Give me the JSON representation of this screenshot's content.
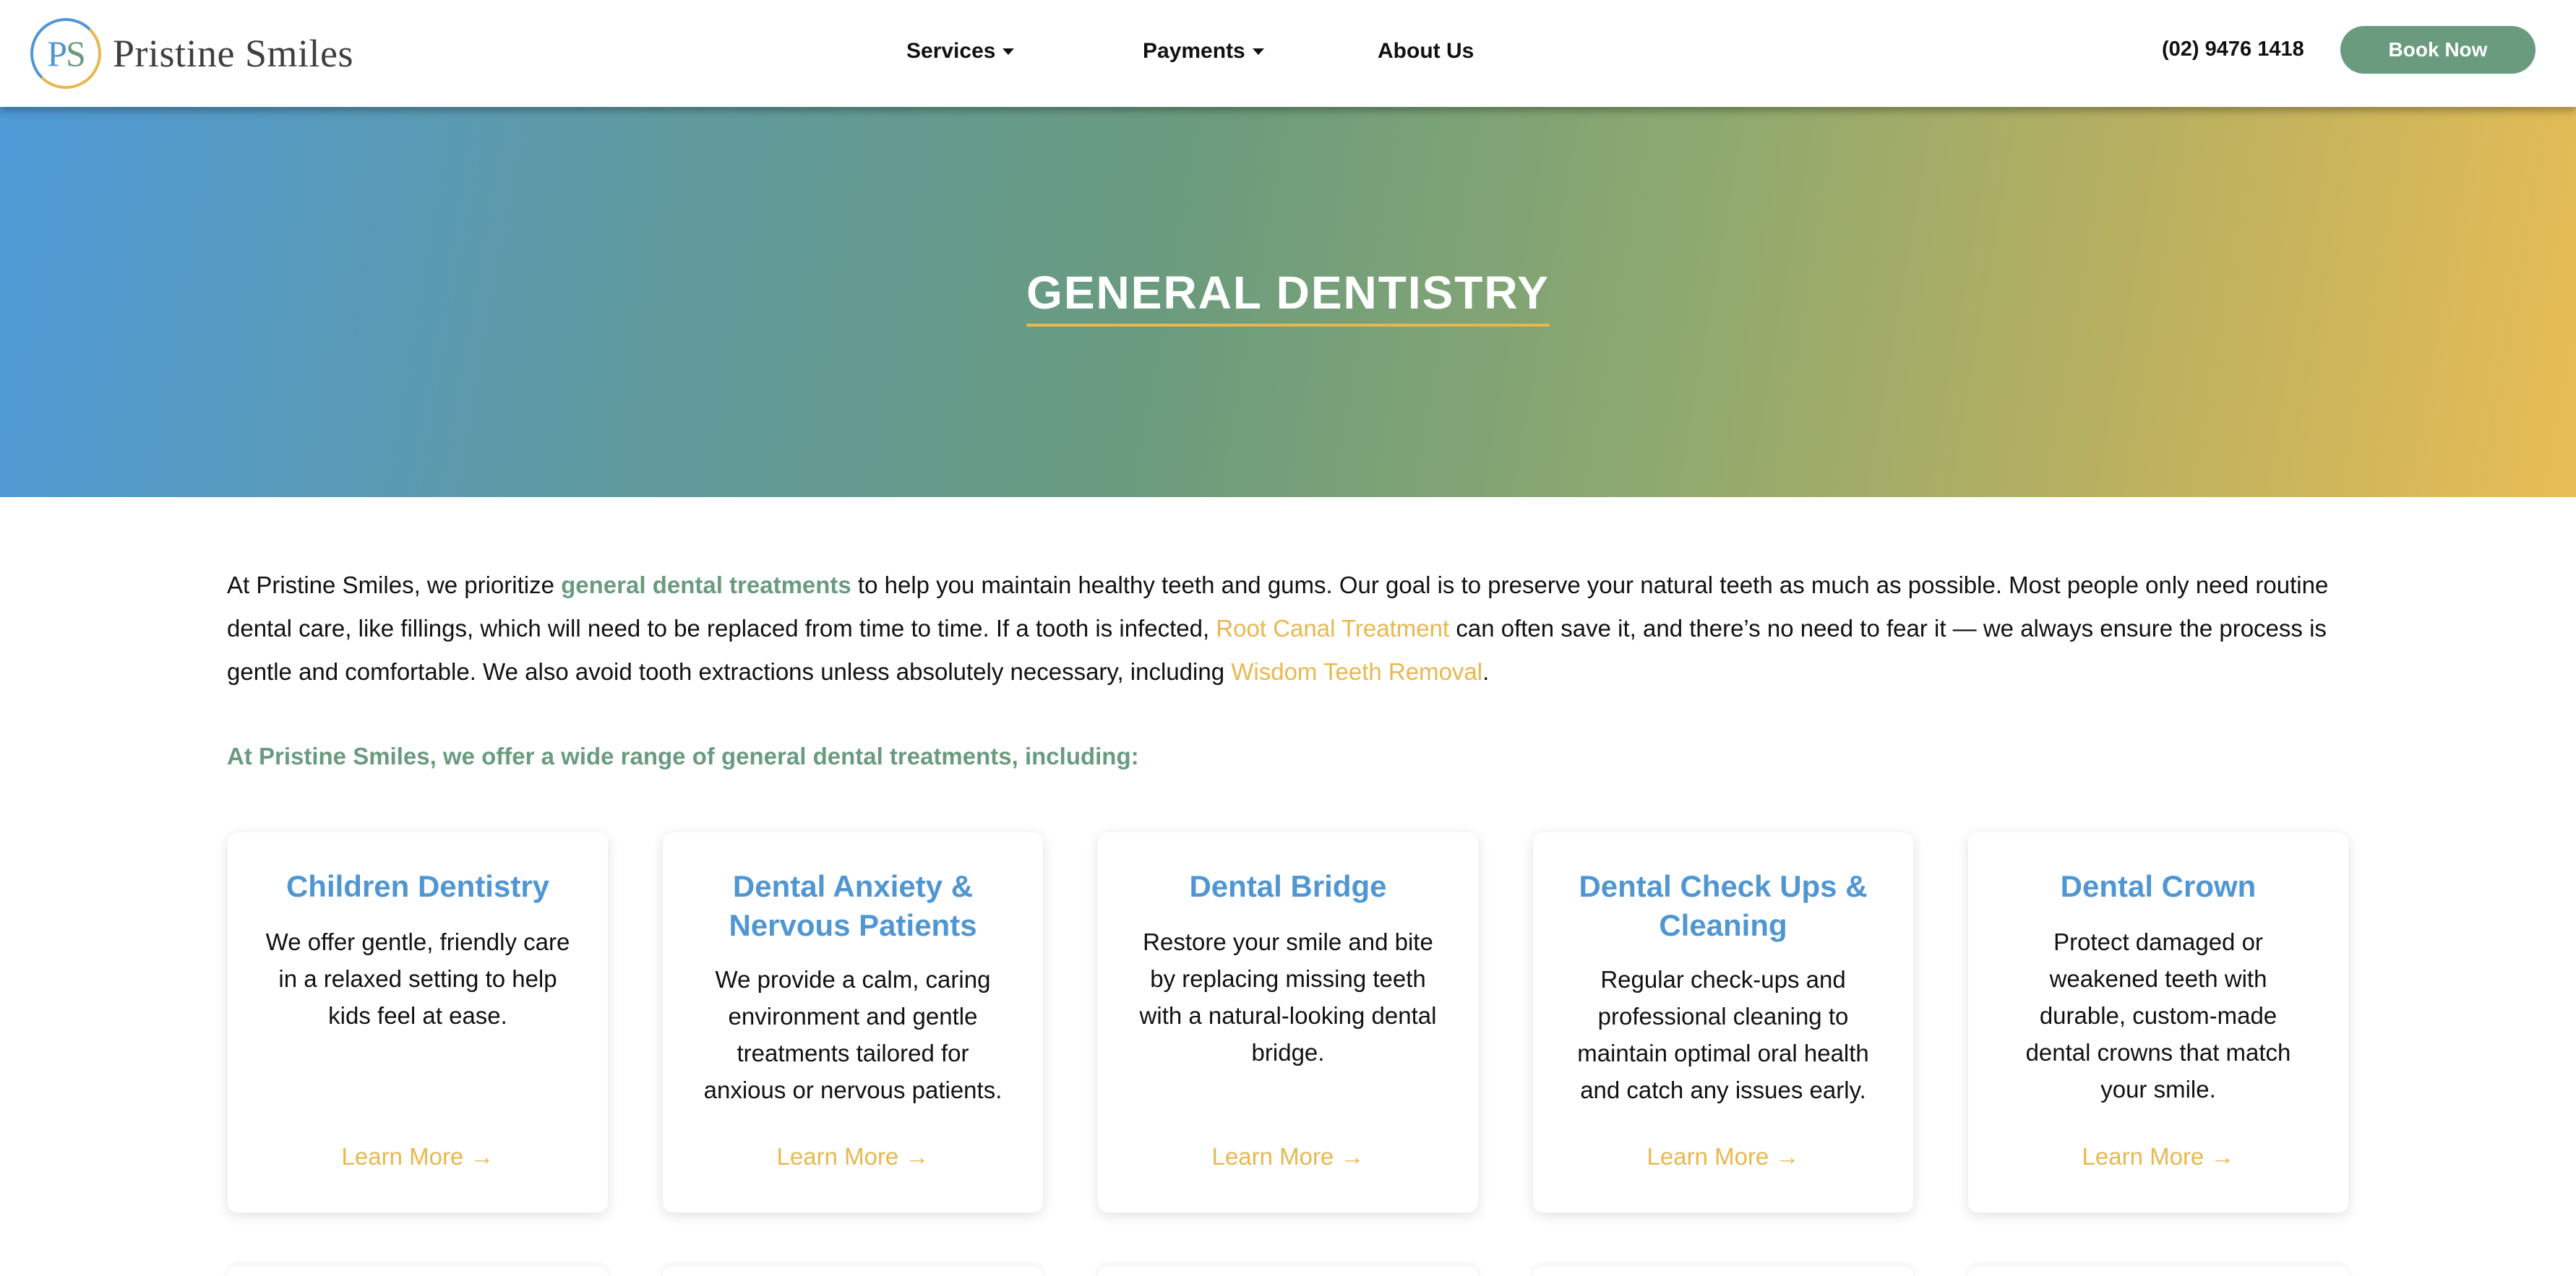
{
  "colors": {
    "brand_green": "#6a9b7e",
    "brand_blue": "#4f96d3",
    "brand_gold": "#e8b84e"
  },
  "header": {
    "logo_initials": "PS",
    "brand_name": "Pristine Smiles",
    "nav": [
      {
        "label": "Services",
        "has_dropdown": true
      },
      {
        "label": "Payments",
        "has_dropdown": true
      },
      {
        "label": "About Us",
        "has_dropdown": false
      }
    ],
    "phone": "(02) 9476 1418",
    "book_label": "Book Now"
  },
  "hero": {
    "title": "GENERAL DENTISTRY"
  },
  "intro": {
    "p1": "At Pristine Smiles, we prioritize ",
    "link1": "general dental treatments",
    "p2": " to help you maintain healthy teeth and gums. Our goal is to preserve your natural teeth as much as possible. Most people only need routine dental care, like fillings, which will need to be replaced from time to time. If a tooth is infected, ",
    "link2": "Root Canal Treatment",
    "p3": " can often save it, and there’s no need to fear it — we always ensure the process is gentle and comfortable. We also avoid tooth extractions unless absolutely necessary, including ",
    "link3": "Wisdom Teeth Removal",
    "p4": "."
  },
  "offer_heading": "At Pristine Smiles, we offer a wide range of general dental treatments, including:",
  "cards": [
    {
      "title": "Children Dentistry",
      "desc": "We offer gentle, friendly care in a relaxed setting to help kids feel at ease.",
      "cta": "Learn More →"
    },
    {
      "title": "Dental Anxiety & Nervous Patients",
      "desc": "We provide a calm, caring environment and gentle treatments tailored for anxious or nervous patients.",
      "cta": "Learn More →"
    },
    {
      "title": "Dental Bridge",
      "desc": "Restore your smile and bite by replacing missing teeth with a natural-looking dental bridge.",
      "cta": "Learn More →"
    },
    {
      "title": "Dental Check Ups & Cleaning",
      "desc": "Regular check-ups and professional cleaning to maintain optimal oral health and catch any issues early.",
      "cta": "Learn More →"
    },
    {
      "title": "Dental Crown",
      "desc": "Protect damaged or weakened teeth with durable, custom-made dental crowns that match your smile.",
      "cta": "Learn More →"
    }
  ]
}
